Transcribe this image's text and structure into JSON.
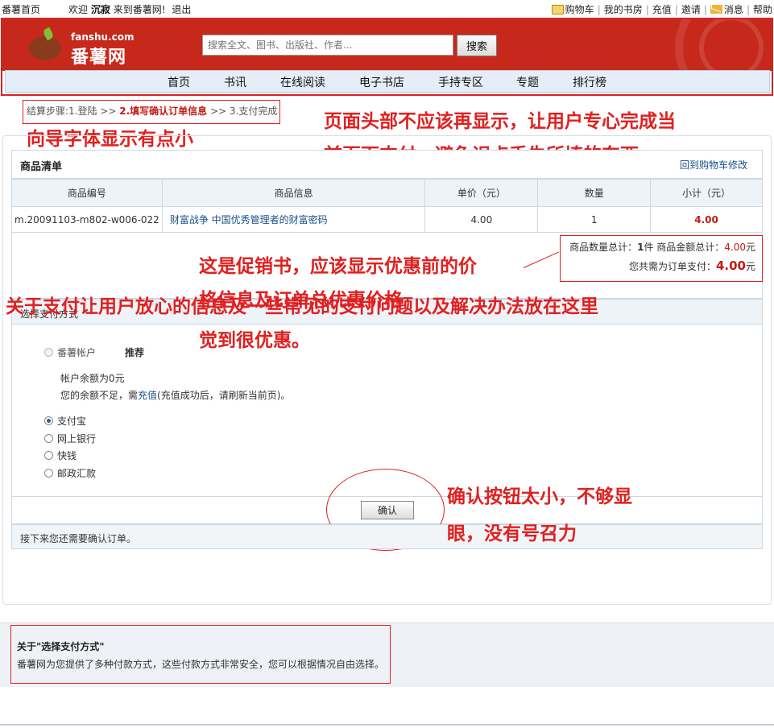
{
  "topbar": {
    "home": "番薯首页",
    "welcome_pre": "欢迎",
    "username": "沉寂",
    "welcome_post": "来到番薯网!",
    "logout": "退出",
    "links": [
      "购物车",
      "我的书房",
      "充值",
      "邀请",
      "消息",
      "帮助"
    ]
  },
  "header": {
    "logo_domain": "fanshu.com",
    "logo_name": "番薯网",
    "search_placeholder": "搜索全文、图书、出版社、作者...",
    "search_button": "搜索"
  },
  "nav": [
    "首页",
    "书讯",
    "在线阅读",
    "电子书店",
    "手持专区",
    "专题",
    "排行榜"
  ],
  "steps": {
    "prefix": "结算步骤:1.登陆 >> ",
    "current": "2.填写确认订单信息",
    "suffix": " >> 3.支付完成"
  },
  "goods": {
    "title": "商品清单",
    "back_link": "回到购物车修改",
    "columns": [
      "商品编号",
      "商品信息",
      "单价（元）",
      "数量",
      "小计（元）"
    ],
    "rows": [
      {
        "id": "m.20091103-m802-w006-022",
        "name": "财富战争 中国优秀管理者的财富密码",
        "price": "4.00",
        "qty": "1",
        "subtotal": "4.00"
      }
    ]
  },
  "summary": {
    "count_label": "商品数量总计：",
    "count": "1",
    "count_unit": "件 商品金额总计：",
    "amount": "4.00",
    "amount_unit": "元",
    "pay_label": "您共需为订单支付：",
    "pay_amount": "4.00",
    "pay_unit": "元"
  },
  "payment": {
    "title": "选择支付方式",
    "account_label": "番薯帐户",
    "recommend": "推荐",
    "balance": "帐户余额为0元",
    "insufficient_pre": "您的余额不足，需",
    "recharge": "充值",
    "insufficient_post": "(充值成功后，请刷新当前页)。",
    "methods": [
      "支付宝",
      "网上银行",
      "快钱",
      "邮政汇款"
    ],
    "selected": "支付宝",
    "confirm": "确认",
    "next_tip": "接下来您还需要确认订单。"
  },
  "help": {
    "title": "关于\"选择支付方式\"",
    "desc": "番薯网为您提供了多种付款方式，这些付款方式非常安全，您可以根据情况自由选择。"
  },
  "annotations": {
    "nav_font": "向导字体显示有点小",
    "header_line1": "页面头部不应该再显示，让用户专心完成当",
    "header_line2": "前页面支付，避免误点丢失所填的东西",
    "promo_line1": "这是促销书，应该显示优惠前的价",
    "promo_line2": "格信息及订单总优惠价格",
    "promo_line3": "觉到很优惠。",
    "reassure": "关于支付让用户放心的信息及一些常见的支付问题以及解决办法放在这里",
    "confirm_line1": "确认按钮太小，不够显",
    "confirm_line2": "眼，没有号召力"
  },
  "colors": {
    "header_red": "#c7281c",
    "annotation_red": "#e02020",
    "price_red": "#c41a14",
    "link_blue": "#1a4f8a"
  }
}
